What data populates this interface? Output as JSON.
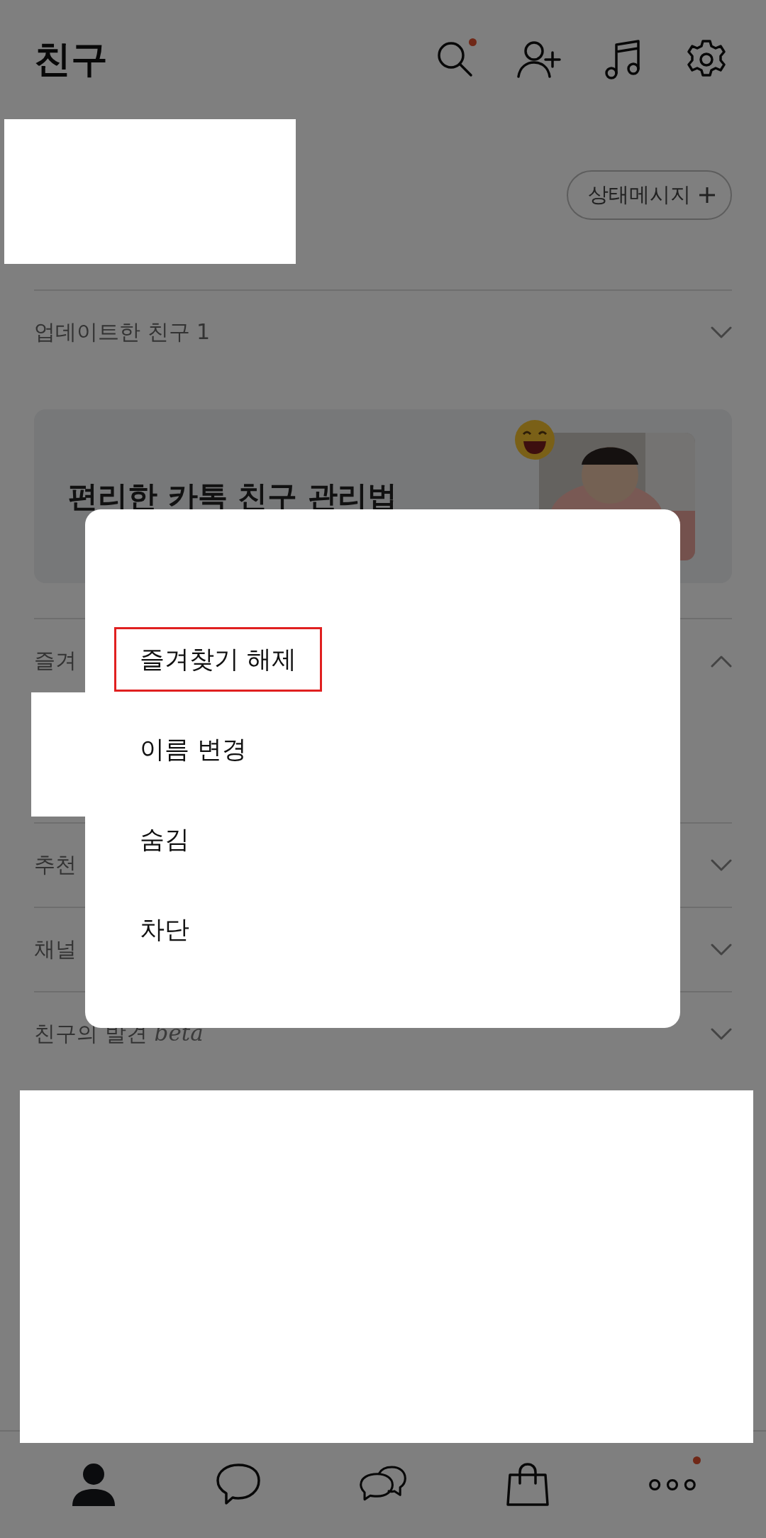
{
  "header": {
    "title": "친구",
    "icons": [
      {
        "kind": "search",
        "badge": true
      },
      {
        "kind": "add-friend",
        "badge": false
      },
      {
        "kind": "music",
        "badge": false
      },
      {
        "kind": "settings",
        "badge": false
      }
    ]
  },
  "profile": {
    "status_button": "상태메시지"
  },
  "updates": {
    "label": "업데이트한 친구 1",
    "expanded": false
  },
  "banner": {
    "title": "편리한 카톡 친구 관리법"
  },
  "sections": [
    {
      "label": "즐겨",
      "expanded": true
    },
    {
      "label": "추천",
      "expanded": false
    },
    {
      "label": "채널",
      "expanded": false
    },
    {
      "label": "친구의 발견",
      "tag": "beta",
      "expanded": false
    }
  ],
  "menu": {
    "items": [
      {
        "label": "즐겨찾기 해제",
        "highlighted": true
      },
      {
        "label": "이름 변경",
        "highlighted": false
      },
      {
        "label": "숨김",
        "highlighted": false
      },
      {
        "label": "차단",
        "highlighted": false
      }
    ]
  },
  "bottom_nav": [
    {
      "kind": "person",
      "selected": true,
      "badge": false
    },
    {
      "kind": "chat",
      "selected": false,
      "badge": false
    },
    {
      "kind": "chats",
      "selected": false,
      "badge": false
    },
    {
      "kind": "bag",
      "selected": false,
      "badge": false
    },
    {
      "kind": "more",
      "selected": false,
      "badge": true
    }
  ]
}
